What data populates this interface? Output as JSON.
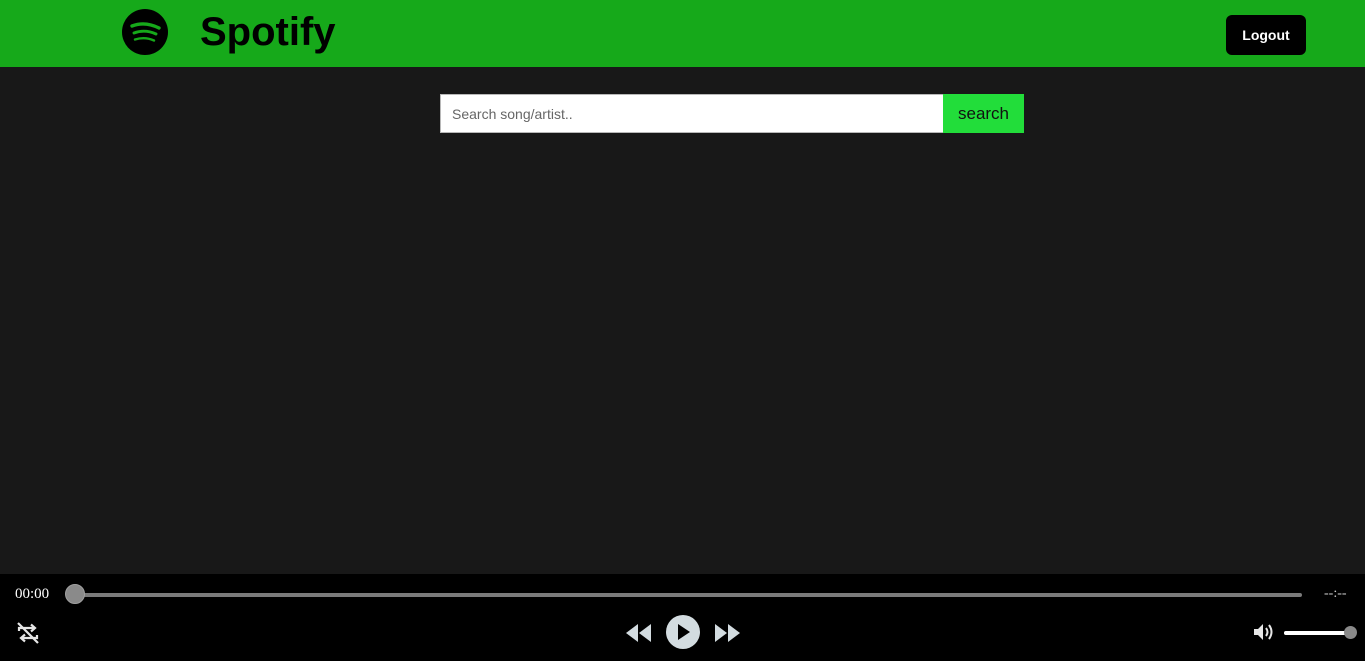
{
  "header": {
    "brand": "Spotify",
    "logout_label": "Logout",
    "bg_color": "#16a91a"
  },
  "search": {
    "placeholder": "Search song/artist..",
    "value": "",
    "button_label": "search"
  },
  "player": {
    "current_time": "00:00",
    "total_time": "--:--",
    "progress_fraction": 0,
    "volume_fraction": 1,
    "icons": {
      "repeat": "repeat-off-icon",
      "rewind": "rewind-icon",
      "play": "play-icon",
      "forward": "fast-forward-icon",
      "volume": "volume-icon"
    }
  }
}
